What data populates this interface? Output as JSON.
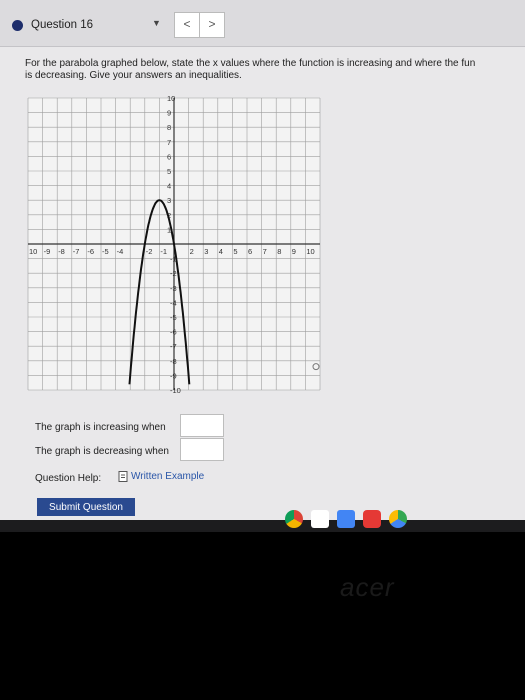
{
  "header": {
    "question_label": "Question 16",
    "prev_label": "<",
    "next_label": ">"
  },
  "prompt": {
    "line1": "For the parabola graphed below, state the x values where the function is increasing and where the fun",
    "line2": "is decreasing. Give your answers an inequalities."
  },
  "graph": {
    "x_ticks": [
      "10",
      "-9",
      "-8",
      "-7",
      "-6",
      "-5",
      "-4",
      "",
      "-2",
      "-1",
      "",
      "2",
      "3",
      "4",
      "5",
      "6",
      "7",
      "8",
      "9",
      "10"
    ],
    "y_ticks_pos": [
      "10",
      "9",
      "8",
      "7",
      "6",
      "5",
      "4",
      "3",
      "2",
      "1"
    ],
    "y_ticks_neg": [
      "-1",
      "-2",
      "-3",
      "-4",
      "-5",
      "-6",
      "-7",
      "-8",
      "-9",
      "-10"
    ],
    "vertex": [
      -1,
      3
    ],
    "a": -3,
    "colors": {
      "curve": "#111111",
      "grid": "#9e9e9e",
      "axis": "#333333"
    }
  },
  "answers": {
    "increasing_label": "The graph is increasing when",
    "decreasing_label": "The graph is decreasing when",
    "increasing_value": "",
    "decreasing_value": ""
  },
  "help": {
    "label": "Question Help:",
    "link": "Written Example"
  },
  "submit_label": "Submit Question",
  "laptop_logo": "acer"
}
